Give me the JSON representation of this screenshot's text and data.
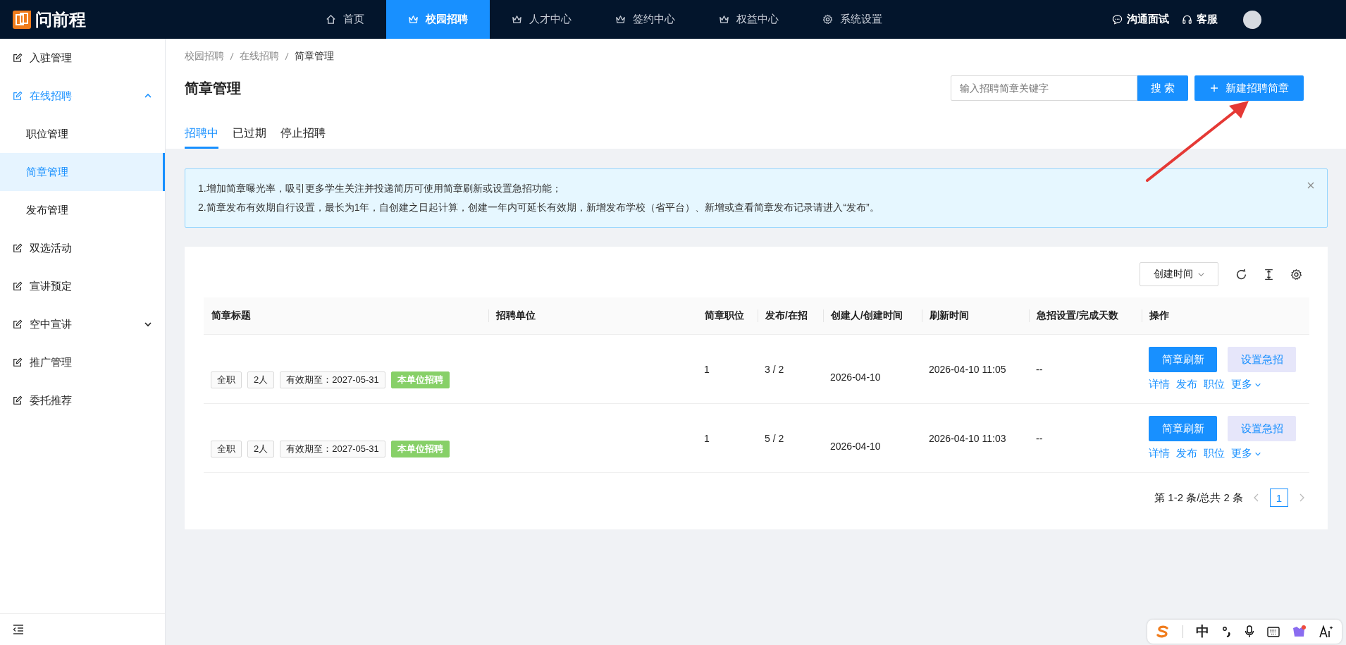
{
  "topbar": {
    "logo_text": "问前程",
    "nav": [
      {
        "label": "首页",
        "kind": "home",
        "selected": false
      },
      {
        "label": "校园招聘",
        "kind": "crown",
        "selected": true
      },
      {
        "label": "人才中心",
        "kind": "crown",
        "selected": false
      },
      {
        "label": "签约中心",
        "kind": "crown",
        "selected": false
      },
      {
        "label": "权益中心",
        "kind": "crown",
        "selected": false
      },
      {
        "label": "系统设置",
        "kind": "gear",
        "selected": false
      }
    ],
    "actions": [
      {
        "label": "沟通面试",
        "kind": "chat"
      },
      {
        "label": "客服",
        "kind": "headset"
      }
    ]
  },
  "sidebar": {
    "items": [
      {
        "label": "入驻管理",
        "kind": "link"
      },
      {
        "label": "在线招聘",
        "kind": "group",
        "expanded": true,
        "children": [
          {
            "label": "职位管理",
            "selected": false
          },
          {
            "label": "简章管理",
            "selected": true
          },
          {
            "label": "发布管理",
            "selected": false
          }
        ]
      },
      {
        "label": "双选活动",
        "kind": "link"
      },
      {
        "label": "宣讲预定",
        "kind": "link"
      },
      {
        "label": "空中宣讲",
        "kind": "group",
        "expanded": false
      },
      {
        "label": "推广管理",
        "kind": "link"
      },
      {
        "label": "委托推荐",
        "kind": "link"
      }
    ]
  },
  "breadcrumb": [
    "校园招聘",
    "在线招聘",
    "简章管理"
  ],
  "page_title": "简章管理",
  "search": {
    "placeholder": "输入招聘简章关键字",
    "button": "搜 索"
  },
  "new_button": "新建招聘简章",
  "tabs": [
    {
      "label": "招聘中",
      "selected": true
    },
    {
      "label": "已过期",
      "selected": false
    },
    {
      "label": "停止招聘",
      "selected": false
    }
  ],
  "notice": [
    "1.增加简章曝光率，吸引更多学生关注并投递简历可使用简章刷新或设置急招功能；",
    "2.简章发布有效期自行设置，最长为1年，自创建之日起计算，创建一年内可延长有效期，新增发布学校（省平台）、新增或查看简章发布记录请进入“发布”。"
  ],
  "table": {
    "sort": "创建时间",
    "columns": [
      "简章标题",
      "招聘单位",
      "简章职位",
      "发布/在招",
      "创建人/创建时间",
      "刷新时间",
      "急招设置/完成天数",
      "操作"
    ],
    "rows": [
      {
        "tags": [
          {
            "label": "全职",
            "kind": "plain"
          },
          {
            "label": "2人",
            "kind": "plain"
          },
          {
            "label": "有效期至：2027-05-31",
            "kind": "plain"
          },
          {
            "label": "本单位招聘",
            "kind": "highlight"
          }
        ],
        "positions": "1",
        "published": "3 / 2",
        "created": "2026-04-10",
        "refreshed": "2026-04-10 11:05",
        "urgent": "--",
        "buttons": [
          "简章刷新",
          "设置急招"
        ],
        "links": [
          "详情",
          "发布",
          "职位",
          "更多"
        ]
      },
      {
        "tags": [
          {
            "label": "全职",
            "kind": "plain"
          },
          {
            "label": "2人",
            "kind": "plain"
          },
          {
            "label": "有效期至：2027-05-31",
            "kind": "plain"
          },
          {
            "label": "本单位招聘",
            "kind": "highlight"
          }
        ],
        "positions": "1",
        "published": "5 / 2",
        "created": "2026-04-10",
        "refreshed": "2026-04-10 11:03",
        "urgent": "--",
        "buttons": [
          "简章刷新",
          "设置急招"
        ],
        "links": [
          "详情",
          "发布",
          "职位",
          "更多"
        ]
      }
    ],
    "pagination": {
      "summary": "第 1-2 条/总共 2 条",
      "pages": [
        {
          "label": "1",
          "selected": true
        }
      ]
    }
  },
  "ime_bar": {
    "mode": "中"
  }
}
